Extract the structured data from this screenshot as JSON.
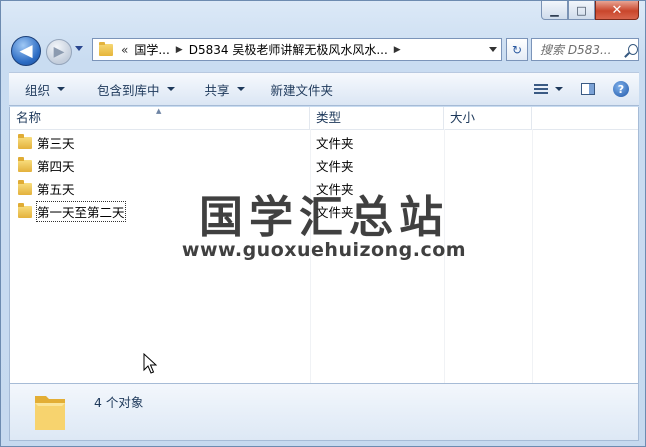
{
  "window": {
    "caption_buttons": {
      "minimize": "▁",
      "maximize": "□",
      "close": "✕"
    }
  },
  "navigation": {
    "back_glyph": "◀",
    "forward_glyph": "▶",
    "breadcrumb_overflow": "«",
    "breadcrumbs": [
      "国学...",
      "D5834 吴极老师讲解无极风水风水..."
    ],
    "crumb_separator": "▶",
    "refresh_glyph": "↻",
    "search_placeholder": "搜索 D583..."
  },
  "toolbar": {
    "organize": "组织",
    "include_in_library": "包含到库中",
    "share": "共享",
    "new_folder": "新建文件夹",
    "help": "?"
  },
  "columns": {
    "name": "名称",
    "type": "类型",
    "size": "大小"
  },
  "files": [
    {
      "name": "第三天",
      "type": "文件夹"
    },
    {
      "name": "第四天",
      "type": "文件夹"
    },
    {
      "name": "第五天",
      "type": "文件夹"
    },
    {
      "name": "第一天至第二天",
      "type": "文件夹"
    }
  ],
  "watermark": {
    "title": "国学汇总站",
    "url": "www.guoxuehuizong.com"
  },
  "status": {
    "item_count": "4 个对象"
  },
  "colors": {
    "folder": "#e8b63e",
    "accent": "#2c6cc4"
  }
}
